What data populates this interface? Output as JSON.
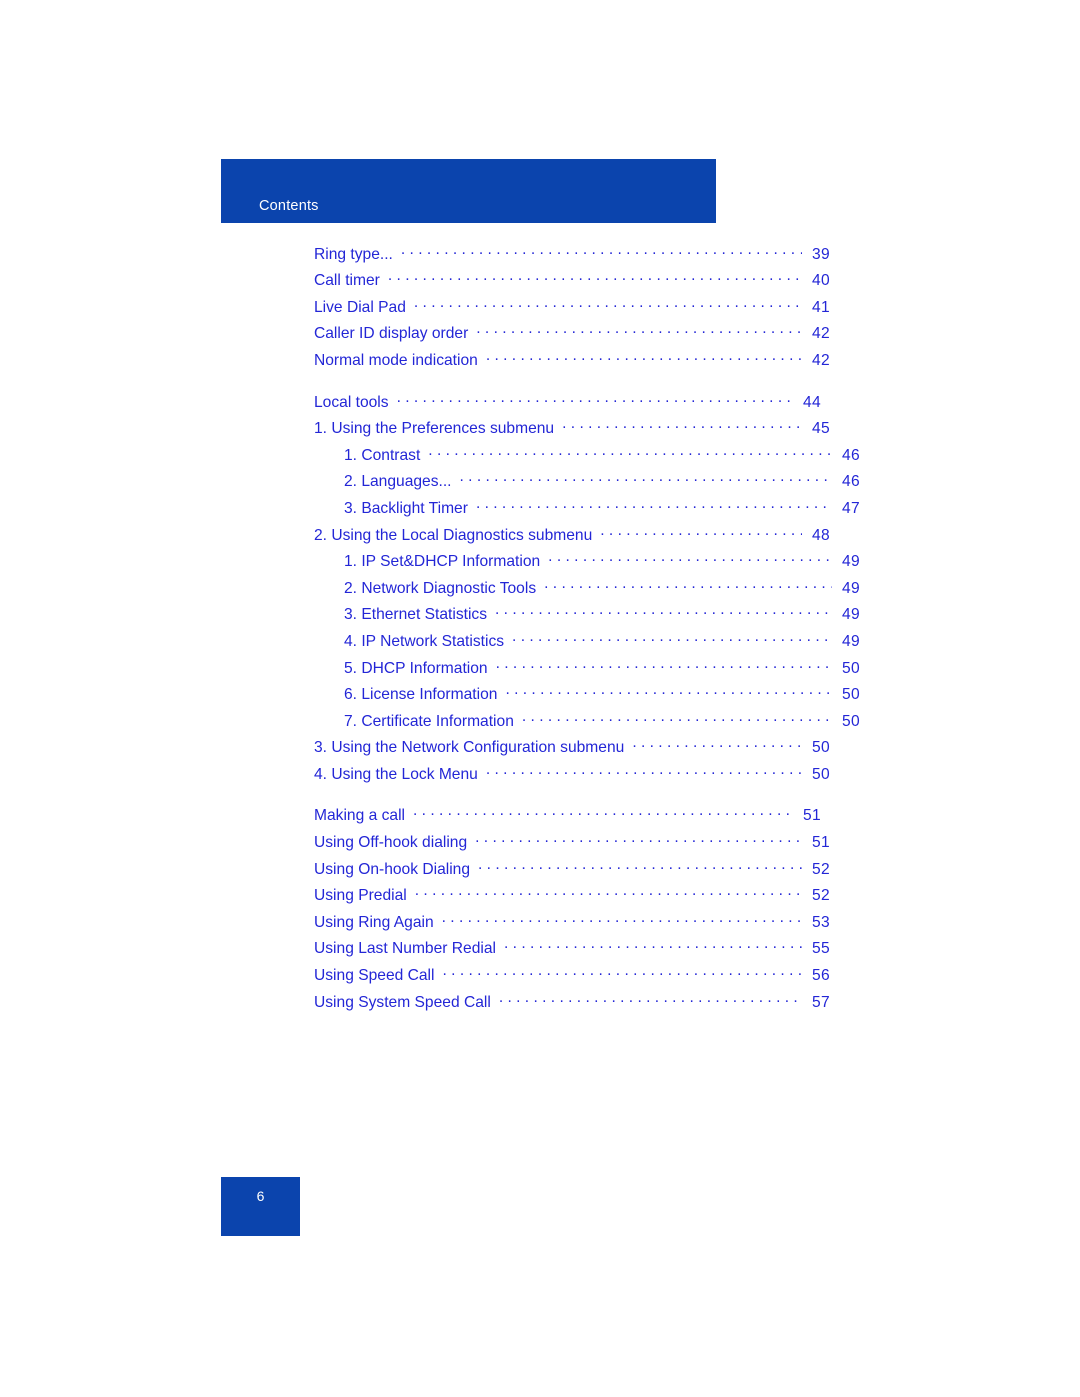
{
  "header": {
    "title": "Contents"
  },
  "footer": {
    "page_number": "6"
  },
  "colors": {
    "banner_blue": "#0b44ad",
    "link_blue": "#2326d6",
    "header_text": "#ffffff"
  },
  "toc": {
    "entries": [
      {
        "label": "Ring type...",
        "page": "39",
        "level": 2,
        "section_start": false
      },
      {
        "label": "Call timer",
        "page": "40",
        "level": 2,
        "section_start": false
      },
      {
        "label": "Live Dial Pad",
        "page": "41",
        "level": 2,
        "section_start": false
      },
      {
        "label": "Caller ID display order",
        "page": "42",
        "level": 2,
        "section_start": false
      },
      {
        "label": "Normal mode indication",
        "page": "42",
        "level": 2,
        "section_start": false
      },
      {
        "label": "Local tools",
        "page": "44",
        "level": 1,
        "section_start": true
      },
      {
        "label": "1. Using the Preferences submenu",
        "page": "45",
        "level": 2,
        "section_start": false
      },
      {
        "label": "1. Contrast",
        "page": "46",
        "level": 3,
        "section_start": false
      },
      {
        "label": "2. Languages...",
        "page": "46",
        "level": 3,
        "section_start": false
      },
      {
        "label": "3. Backlight Timer",
        "page": "47",
        "level": 3,
        "section_start": false
      },
      {
        "label": "2. Using the Local Diagnostics submenu",
        "page": "48",
        "level": 2,
        "section_start": false
      },
      {
        "label": "1. IP Set&DHCP Information",
        "page": "49",
        "level": 3,
        "section_start": false
      },
      {
        "label": "2. Network Diagnostic Tools",
        "page": "49",
        "level": 3,
        "section_start": false
      },
      {
        "label": "3. Ethernet Statistics",
        "page": "49",
        "level": 3,
        "section_start": false
      },
      {
        "label": "4. IP Network Statistics",
        "page": "49",
        "level": 3,
        "section_start": false
      },
      {
        "label": "5. DHCP Information",
        "page": "50",
        "level": 3,
        "section_start": false
      },
      {
        "label": "6. License Information",
        "page": "50",
        "level": 3,
        "section_start": false
      },
      {
        "label": "7. Certificate Information",
        "page": "50",
        "level": 3,
        "section_start": false
      },
      {
        "label": "3. Using the Network Configuration submenu",
        "page": "50",
        "level": 2,
        "section_start": false
      },
      {
        "label": "4. Using the Lock Menu",
        "page": "50",
        "level": 2,
        "section_start": false
      },
      {
        "label": "Making a call",
        "page": "51",
        "level": 1,
        "section_start": true
      },
      {
        "label": "Using Off-hook dialing",
        "page": "51",
        "level": 2,
        "section_start": false
      },
      {
        "label": "Using On-hook Dialing",
        "page": "52",
        "level": 2,
        "section_start": false
      },
      {
        "label": "Using Predial",
        "page": "52",
        "level": 2,
        "section_start": false
      },
      {
        "label": "Using Ring Again",
        "page": "53",
        "level": 2,
        "section_start": false
      },
      {
        "label": "Using Last Number Redial",
        "page": "55",
        "level": 2,
        "section_start": false
      },
      {
        "label": "Using Speed Call",
        "page": "56",
        "level": 2,
        "section_start": false
      },
      {
        "label": "Using System Speed Call",
        "page": "57",
        "level": 2,
        "section_start": false
      }
    ]
  }
}
